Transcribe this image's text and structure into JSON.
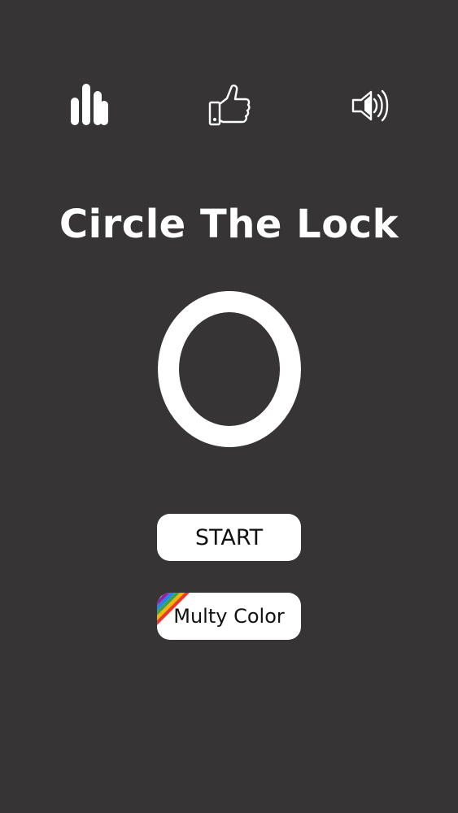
{
  "app": {
    "title": "Circle The Lock"
  },
  "top_bar": {
    "icons": {
      "stats": "bar-chart-icon",
      "like": "thumbs-up-icon",
      "sound": "speaker-icon"
    }
  },
  "menu": {
    "start_label": "START",
    "multy_color_label": "Multy Color"
  },
  "colors": {
    "background": "#363435",
    "foreground": "#ffffff",
    "button_text": "#111111",
    "rainbow": [
      "#e53935",
      "#ffb300",
      "#43a047",
      "#1e88e5",
      "#8e24aa"
    ]
  }
}
